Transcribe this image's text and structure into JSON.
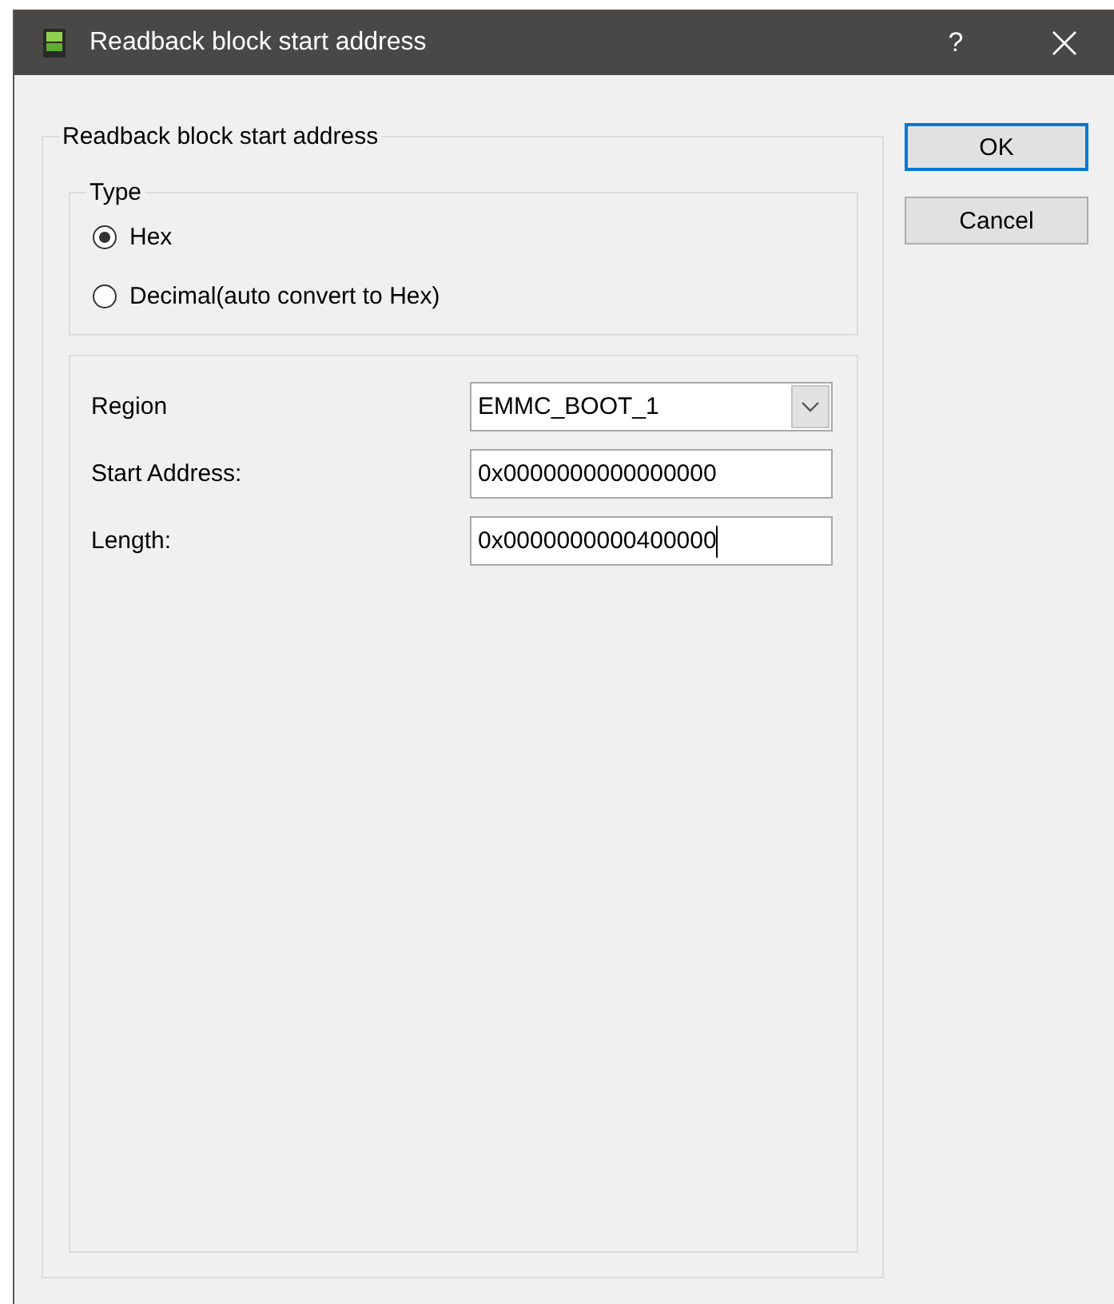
{
  "window": {
    "title": "Readback block start address",
    "help": "?"
  },
  "group": {
    "title": "Readback block start address"
  },
  "type_group": {
    "title": "Type",
    "options": [
      {
        "label": "Hex",
        "selected": true
      },
      {
        "label": "Decimal(auto convert to Hex)",
        "selected": false
      }
    ]
  },
  "fields": [
    {
      "kind": "dropdown",
      "label": "Region",
      "value": "EMMC_BOOT_1"
    },
    {
      "kind": "text",
      "label": "Start Address:",
      "value": "0x0000000000000000"
    },
    {
      "kind": "text",
      "label": "Length:",
      "value": "0x0000000000400000",
      "focused": true
    }
  ],
  "buttons": [
    {
      "label": "OK",
      "default": true
    },
    {
      "label": "Cancel",
      "default": false
    }
  ]
}
